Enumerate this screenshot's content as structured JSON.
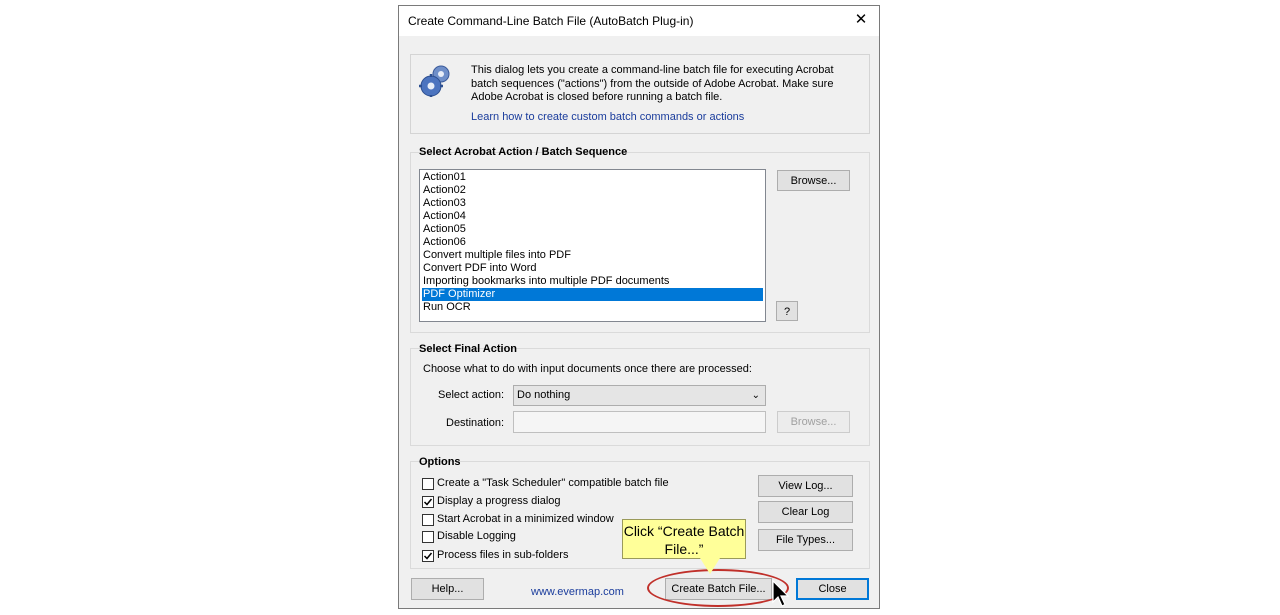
{
  "dialog": {
    "title": "Create Command-Line Batch File (AutoBatch Plug-in)",
    "close_glyph": "✕"
  },
  "info": {
    "icon": "gears-icon",
    "text": "This dialog lets you create a command-line batch file for executing Acrobat batch sequences (\"actions\") from the outside of Adobe Acrobat. Make sure Adobe Acrobat is closed before running a batch file.",
    "link": "Learn how to create custom batch commands or actions"
  },
  "sequence": {
    "label": "Select Acrobat Action / Batch Sequence",
    "items": [
      "Action01",
      "Action02",
      "Action03",
      "Action04",
      "Action05",
      "Action06",
      "Convert multiple files into PDF",
      "Convert PDF into Word",
      "Importing bookmarks into multiple PDF documents",
      "PDF Optimizer",
      "Run OCR"
    ],
    "selected_index": 9,
    "browse_label": "Browse...",
    "help_label": "?"
  },
  "final_action": {
    "label": "Select Final Action",
    "description": "Choose what to do with input documents once there are processed:",
    "select_label": "Select action:",
    "select_value": "Do nothing",
    "destination_label": "Destination:",
    "destination_value": "",
    "browse_label": "Browse..."
  },
  "options": {
    "label": "Options",
    "checkboxes": [
      {
        "label": "Create a \"Task Scheduler\" compatible batch file",
        "checked": false
      },
      {
        "label": "Display a progress dialog",
        "checked": true
      },
      {
        "label": "Start Acrobat in a minimized window",
        "checked": false
      },
      {
        "label": "Disable Logging",
        "checked": false
      },
      {
        "label": "Process files in sub-folders",
        "checked": true
      }
    ],
    "view_log_label": "View Log...",
    "clear_log_label": "Clear Log",
    "file_types_label": "File Types..."
  },
  "footer": {
    "help_label": "Help...",
    "website": "www.evermap.com",
    "create_label": "Create Batch File...",
    "close_label": "Close"
  },
  "callout": {
    "text": "Click “Create Batch File...”"
  },
  "colors": {
    "selection": "#0078d7",
    "link": "#1a3c9c",
    "callout_bg": "#ffff99",
    "highlight_ring": "#c0302a"
  }
}
